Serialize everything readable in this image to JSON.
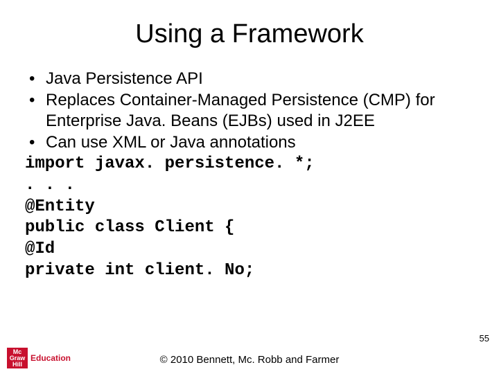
{
  "title": "Using a Framework",
  "bullets": [
    "Java Persistence API",
    "Replaces Container-Managed Persistence (CMP) for Enterprise Java. Beans (EJBs) used in J2EE",
    "Can use XML or Java annotations"
  ],
  "code": "import javax. persistence. *;\n. . .\n@Entity\npublic class Client {\n@Id\nprivate int client. No;",
  "page_number": "55",
  "copyright": "© 2010 Bennett, Mc. Robb and Farmer",
  "logo": {
    "badge_line1": "Mc",
    "badge_line2": "Graw",
    "badge_line3": "Hill",
    "brand": "Education"
  }
}
